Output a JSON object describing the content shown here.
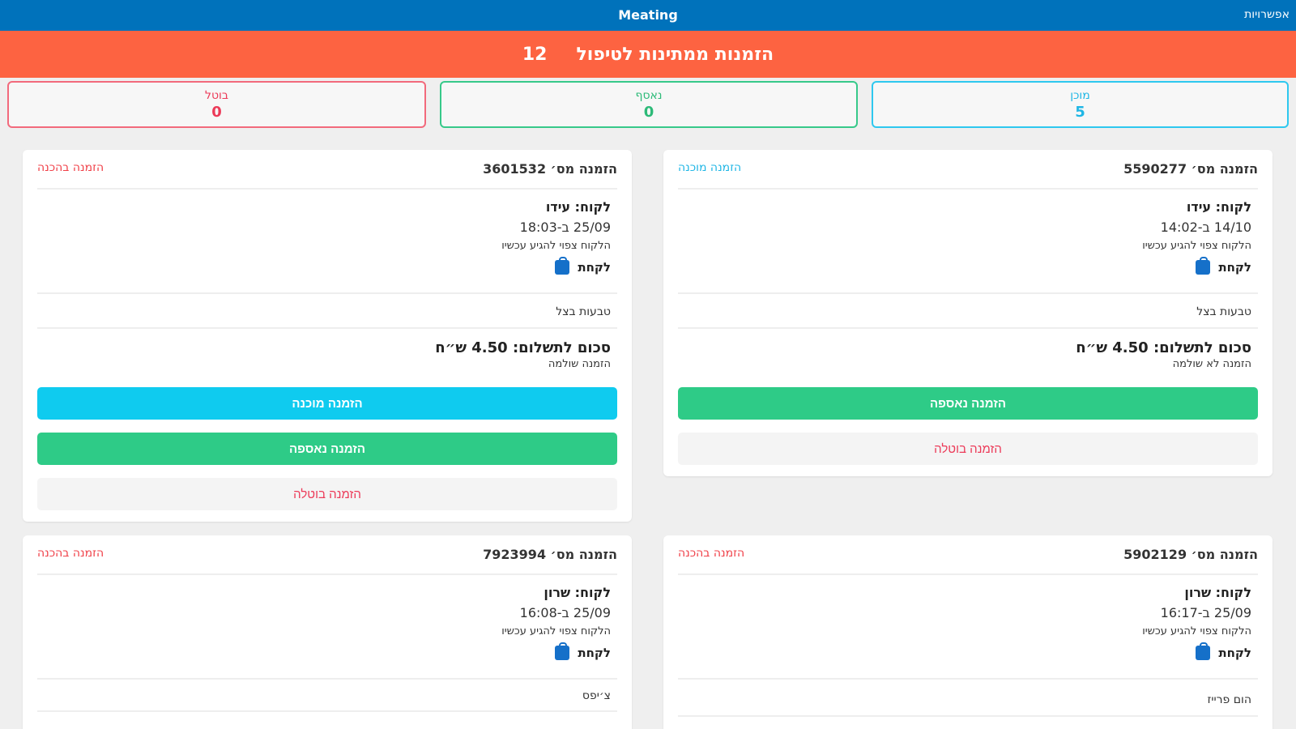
{
  "header": {
    "title": "Meating",
    "options": "אפשרויות"
  },
  "pending": {
    "label": "הזמנות ממתינות לטיפול",
    "count": "12"
  },
  "stats": {
    "ready": {
      "label": "מוכן",
      "value": "5"
    },
    "picked": {
      "label": "נאסף",
      "value": "0"
    },
    "cancelled": {
      "label": "בוטל",
      "value": "0"
    }
  },
  "orders": [
    {
      "number": "הזמנה מס׳ 5590277",
      "status": "הזמנה מוכנה",
      "customer": "לקוח: עידו",
      "datetime": "14/10 ב-14:02",
      "note": "הלקוח צפוי להגיע עכשיו",
      "pickup": "לקחת",
      "item": "טבעות בצל",
      "total": "סכום לתשלום: 4.50 ש״ח",
      "payment": "הזמנה לא שולמה",
      "actions": [
        "הזמנה נאספה",
        "הזמנה בוטלה"
      ]
    },
    {
      "number": "הזמנה מס׳ 3601532",
      "status": "הזמנה בהכנה",
      "customer": "לקוח: עידו",
      "datetime": "25/09 ב-18:03",
      "note": "הלקוח צפוי להגיע עכשיו",
      "pickup": "לקחת",
      "item": "טבעות בצל",
      "total": "סכום לתשלום: 4.50 ש״ח",
      "payment": "הזמנה שולמה",
      "actions": [
        "הזמנה מוכנה",
        "הזמנה נאספה",
        "הזמנה בוטלה"
      ]
    },
    {
      "number": "הזמנה מס׳ 5902129",
      "status": "הזמנה בהכנה",
      "customer": "לקוח: שרון",
      "datetime": "25/09 ב-16:17",
      "note": "הלקוח צפוי להגיע עכשיו",
      "pickup": "לקחת",
      "item": "הום פרייז"
    },
    {
      "number": "הזמנה מס׳ 7923994",
      "status": "הזמנה בהכנה",
      "customer": "לקוח: שרון",
      "datetime": "25/09 ב-16:08",
      "note": "הלקוח צפוי להגיע עכשיו",
      "pickup": "לקחת",
      "item": "צ׳יפס"
    }
  ],
  "colors": {
    "topbar": "#0072bb",
    "pending_banner": "#fd6341",
    "ready": "#0fcbef",
    "picked": "#2ecb87",
    "cancel": "#ec3a58"
  }
}
